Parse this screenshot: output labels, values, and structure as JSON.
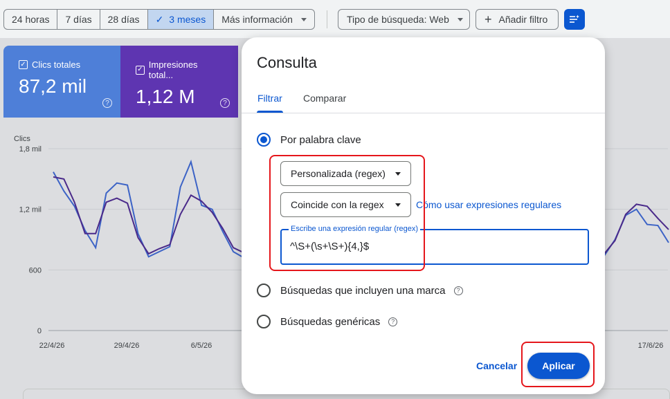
{
  "toolbar": {
    "ranges": [
      {
        "label": "24 horas",
        "active": false
      },
      {
        "label": "7 días",
        "active": false
      },
      {
        "label": "28 días",
        "active": false
      },
      {
        "label": "3 meses",
        "active": true
      },
      {
        "label": "Más información",
        "active": false
      }
    ],
    "search_type": "Tipo de búsqueda: Web",
    "add_filter": "Añadir filtro"
  },
  "cards": {
    "clicks": {
      "label": "Clics totales",
      "value": "87,2 mil",
      "color": "#4e7fd8"
    },
    "impressions": {
      "label": "Impresiones total...",
      "value": "1,12 M",
      "color": "#5e35b1"
    }
  },
  "chart_data": {
    "type": "line",
    "ylabel": "Clics",
    "yticks": [
      "1,8 mil",
      "1,2 mil",
      "600",
      "0"
    ],
    "ylim": [
      0,
      1800
    ],
    "x_labels": [
      "22/4/26",
      "29/4/26",
      "6/5/26",
      "17/6/26"
    ],
    "series": [
      {
        "color": "#3c63c6",
        "values": [
          1570,
          1380,
          1230,
          990,
          820,
          1360,
          1460,
          1440,
          960,
          730,
          780,
          830,
          1420,
          1670,
          1240,
          1200,
          980,
          780,
          720
        ]
      },
      {
        "color": "#4a2a8a",
        "values": [
          1520,
          1500,
          1270,
          960,
          960,
          1270,
          1310,
          1260,
          920,
          760,
          810,
          850,
          1150,
          1340,
          1280,
          1170,
          1010,
          820,
          770
        ]
      }
    ],
    "series_right": [
      {
        "color": "#3c63c6",
        "values": [
          740,
          900,
          1140,
          1200,
          1050,
          1040,
          870
        ]
      },
      {
        "color": "#4a2a8a",
        "values": [
          760,
          890,
          1150,
          1250,
          1230,
          1110,
          1000
        ]
      }
    ]
  },
  "dialog": {
    "title": "Consulta",
    "tabs": [
      "Filtrar",
      "Comparar"
    ],
    "option_keyword": "Por palabra clave",
    "match_type": "Personalizada (regex)",
    "match_mode": "Coincide con la regex",
    "help_link": "Cómo usar expresiones regulares",
    "regex_label": "Escribe una expresión regular (regex)",
    "regex_value": "^\\S+(\\s+\\S+){4,}$",
    "option_brand": "Búsquedas que incluyen una marca",
    "option_generic": "Búsquedas genéricas",
    "cancel": "Cancelar",
    "apply": "Aplicar"
  }
}
